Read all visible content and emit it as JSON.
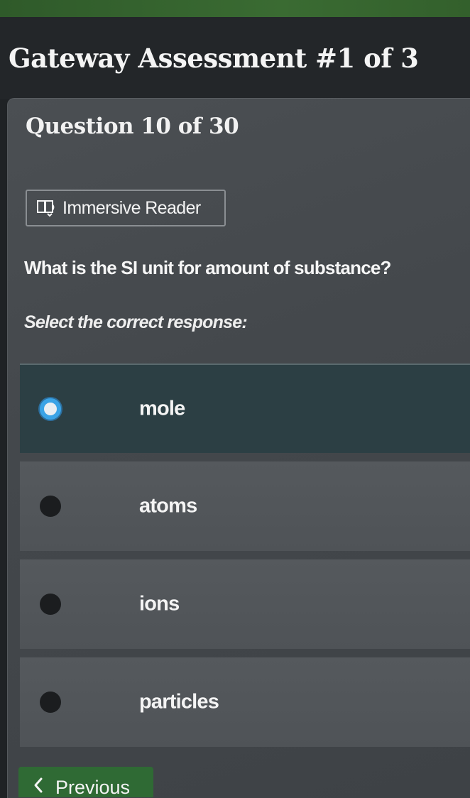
{
  "header": {
    "assessment_title": "Gateway Assessment #1 of 3"
  },
  "question": {
    "counter": "Question 10 of 30",
    "immersive_reader_label": "Immersive Reader",
    "text": "What is the SI unit for amount of substance?",
    "instruction": "Select the correct response:"
  },
  "options": [
    {
      "label": "mole",
      "selected": true
    },
    {
      "label": "atoms",
      "selected": false
    },
    {
      "label": "ions",
      "selected": false
    },
    {
      "label": "particles",
      "selected": false
    }
  ],
  "navigation": {
    "previous_label": "Previous"
  },
  "colors": {
    "accent_green": "#2f6a34",
    "selected_radio": "#3aa3e6",
    "selected_option_bg": "#2c3f44"
  },
  "icons": {
    "reader": "immersive-reader-icon",
    "previous": "chevron-left-icon"
  }
}
